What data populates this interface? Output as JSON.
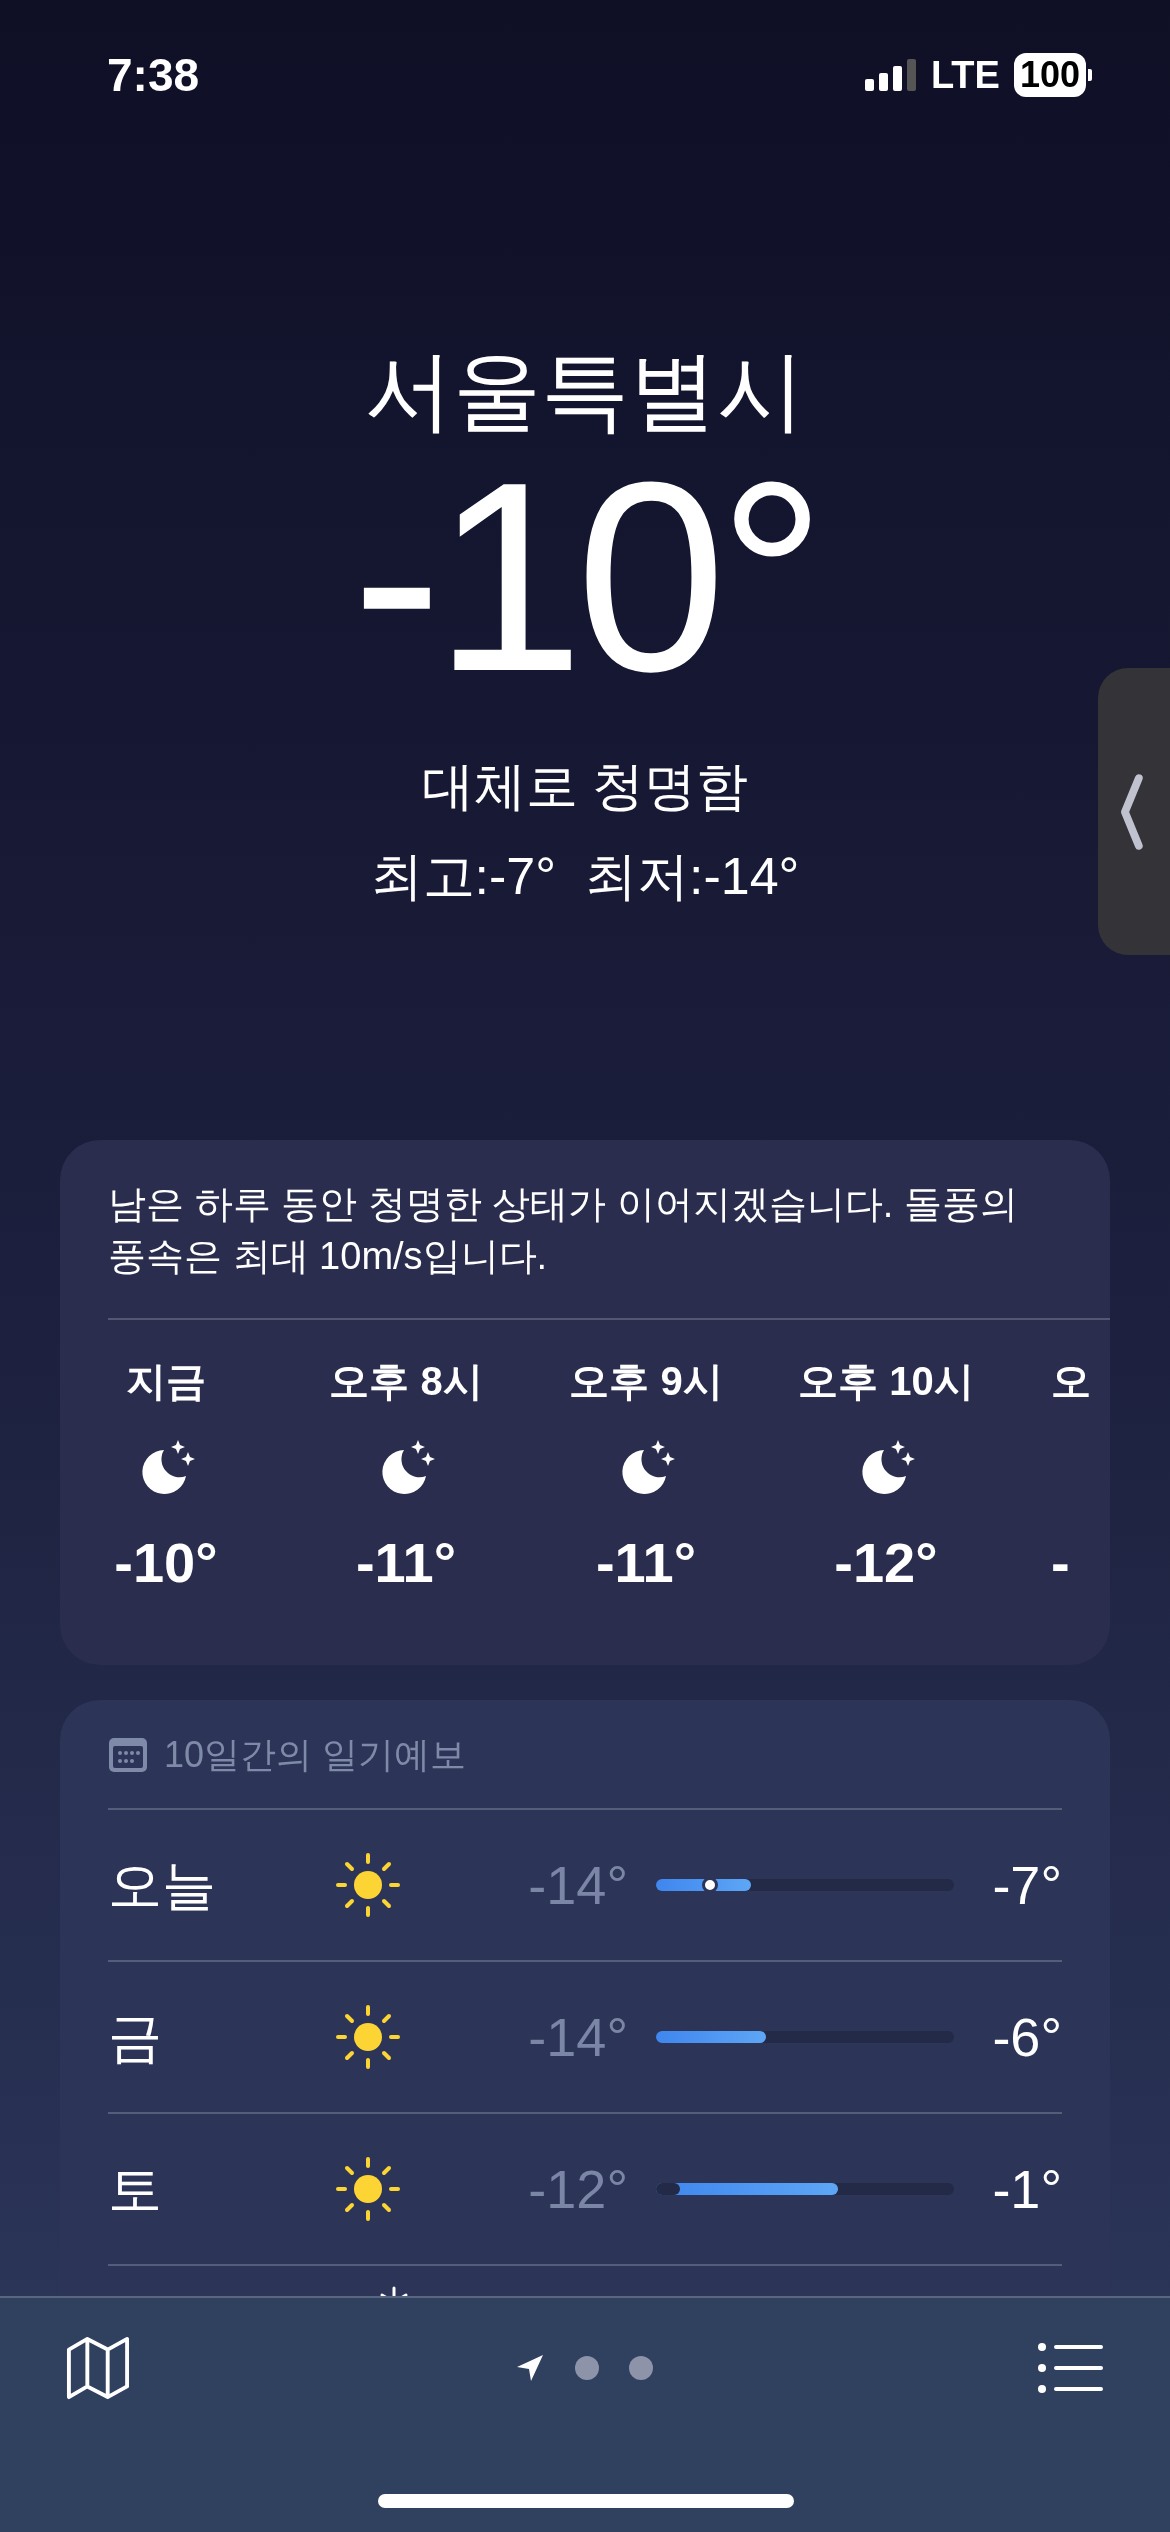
{
  "status_bar": {
    "time": "7:38",
    "network": "LTE",
    "battery": "100"
  },
  "location": {
    "city": "서울특별시",
    "temperature": "-10°",
    "condition": "대체로 청명함",
    "high_low": "최고:-7°  최저:-14°"
  },
  "hourly_card": {
    "summary": "남은 하루 동안 청명한 상태가 이어지겠습니다. 돌풍의 풍속은 최대 10m/s입니다.",
    "hours": [
      {
        "kind": "full",
        "time": "지금",
        "temp": "-10°"
      },
      {
        "kind": "full",
        "time": "오후 8시",
        "temp": "-11°"
      },
      {
        "kind": "full",
        "time": "오후 9시",
        "temp": "-11°"
      },
      {
        "kind": "full",
        "time": "오후 10시",
        "temp": "-12°"
      },
      {
        "kind": "partial",
        "time": "오",
        "temp": "-"
      }
    ]
  },
  "daily_card": {
    "title": "10일간의 일기예보",
    "days": [
      {
        "day": "오늘",
        "low": "-14°",
        "high": "-7°",
        "range": {
          "level": 0.32
        },
        "current": {
          "level": 0.18
        }
      },
      {
        "day": "금",
        "low": "-14°",
        "high": "-6°",
        "range": {
          "level": 0.37
        }
      },
      {
        "day": "토",
        "low": "-12°",
        "high": "-1°",
        "offset": {
          "level": 0.08
        },
        "range": {
          "level": 0.61
        }
      }
    ]
  },
  "pager": {
    "pages": [
      {
        "kind": "location",
        "selected": true
      },
      {
        "kind": "dot",
        "selected": false
      },
      {
        "kind": "dot",
        "selected": false
      }
    ]
  }
}
